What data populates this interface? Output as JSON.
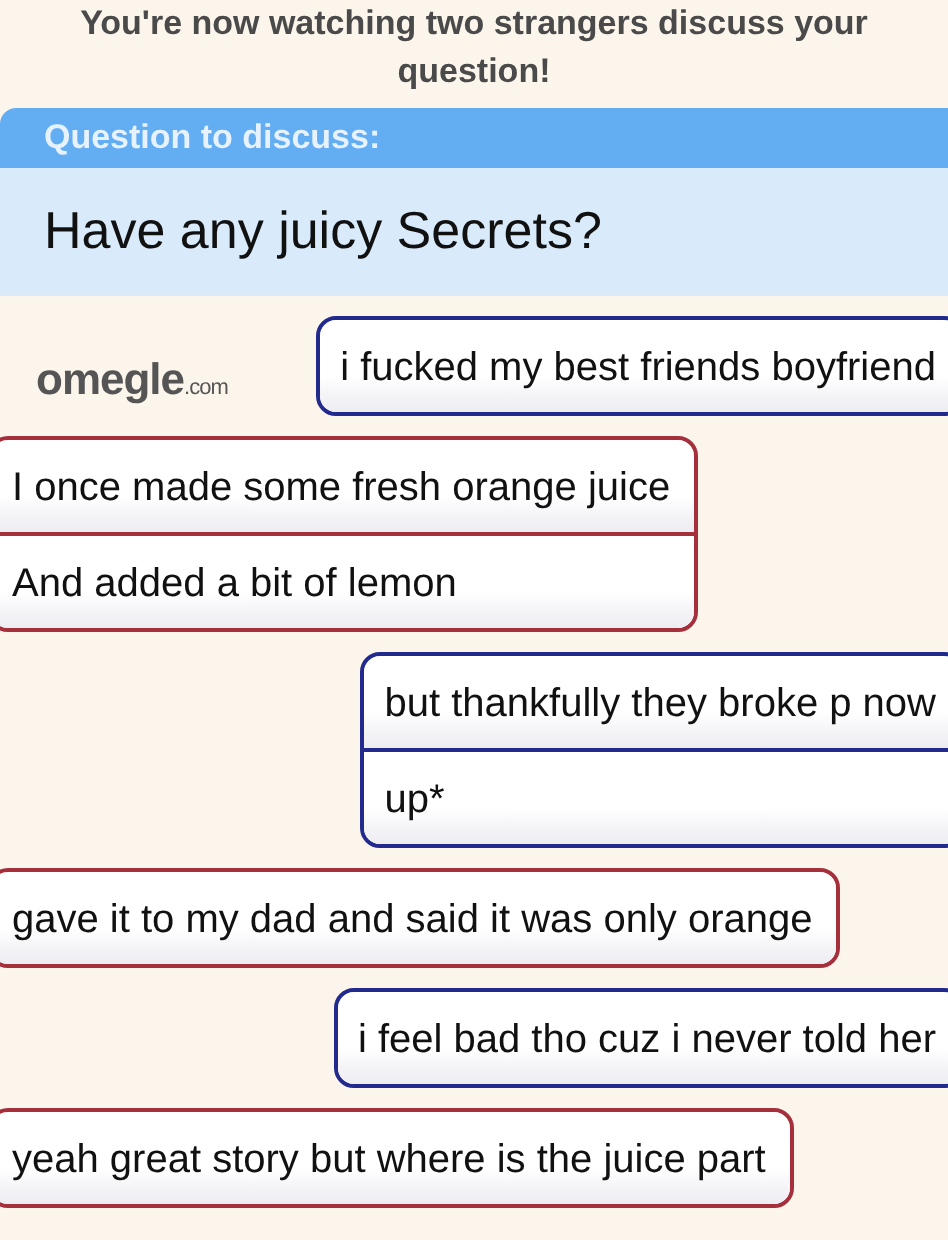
{
  "header": {
    "text": "You're now watching two strangers discuss your question!"
  },
  "question": {
    "label": "Question to discuss:",
    "text": "Have any juicy Secrets?"
  },
  "logo": {
    "name": "omegle",
    "suffix": ".com"
  },
  "messages": [
    {
      "kind": "stranger2",
      "lines": [
        "i fucked my best friends boyfriend"
      ]
    },
    {
      "kind": "stranger1",
      "lines": [
        "I once made some fresh orange juice",
        "And added a bit of lemon"
      ]
    },
    {
      "kind": "stranger2",
      "lines": [
        "but thankfully they broke p now",
        "up*"
      ]
    },
    {
      "kind": "stranger1",
      "lines": [
        "gave it to my dad and said it was only orange"
      ]
    },
    {
      "kind": "stranger2",
      "lines": [
        "i feel bad tho cuz i never told her"
      ]
    },
    {
      "kind": "stranger1",
      "lines": [
        "yeah great story but where is the juice part"
      ]
    }
  ]
}
